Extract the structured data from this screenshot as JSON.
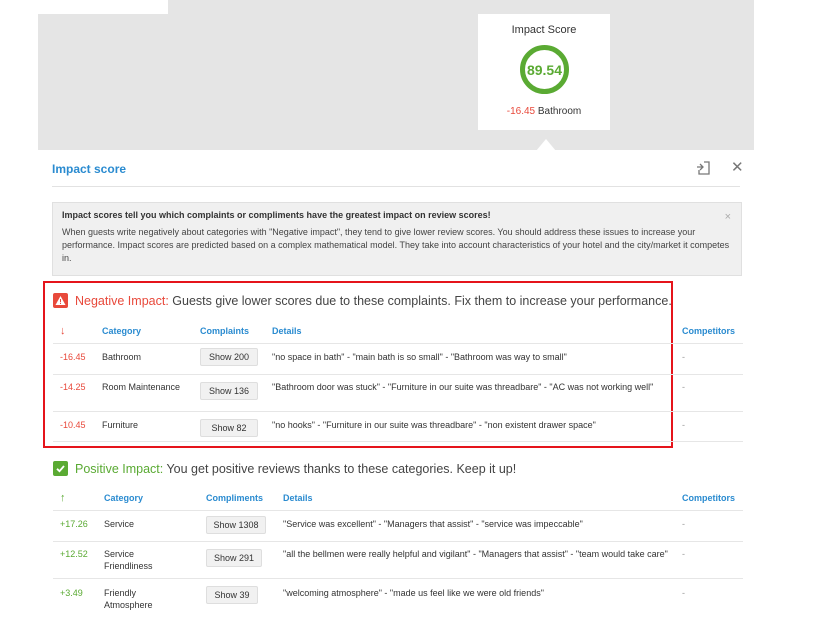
{
  "score_card": {
    "title": "Impact Score",
    "value": "89.54",
    "top_delta": "-16.45",
    "top_category": "Bathroom"
  },
  "panel": {
    "title": "Impact score",
    "close": "✕"
  },
  "info": {
    "title": "Impact scores tell you which complaints or compliments have the greatest impact on review scores!",
    "body": "When guests write negatively about categories with \"Negative impact\", they tend to give lower review scores. You should address these issues to increase your performance. Impact scores are predicted based on a complex mathematical model. They take into account characteristics of your hotel and the city/market it competes in.",
    "close": "×"
  },
  "negative": {
    "lead": "Negative Impact:",
    "text": " Guests give lower scores due to these complaints. Fix them to increase your performance.",
    "headers": {
      "sort": "↓",
      "category": "Category",
      "count": "Complaints",
      "details": "Details",
      "competitors": "Competitors"
    },
    "rows": [
      {
        "score": "-16.45",
        "category": "Bathroom",
        "button": "Show 200",
        "details": "\"no space in bath\" - \"main bath is so small\" - \"Bathroom was way to small\"",
        "competitors": "-"
      },
      {
        "score": "-14.25",
        "category": "Room Maintenance",
        "button": "Show 136",
        "details": "\"Bathroom door was stuck\" - \"Furniture in our suite was threadbare\" - \"AC was not working well\"",
        "competitors": "-"
      },
      {
        "score": "-10.45",
        "category": "Furniture",
        "button": "Show 82",
        "details": "\"no hooks\" - \"Furniture in our suite was threadbare\" - \"non existent drawer space\"",
        "competitors": "-"
      }
    ]
  },
  "positive": {
    "lead": "Positive Impact:",
    "text": " You get positive reviews thanks to these categories. Keep it up!",
    "headers": {
      "sort": "↑",
      "category": "Category",
      "count": "Compliments",
      "details": "Details",
      "competitors": "Competitors"
    },
    "rows": [
      {
        "score": "+17.26",
        "category": "Service",
        "button": "Show 1308",
        "details": "\"Service was excellent\" - \"Managers that assist\" - \"service was impeccable\"",
        "competitors": "-"
      },
      {
        "score": "+12.52",
        "category": "Service Friendliness",
        "button": "Show 291",
        "details": "\"all the bellmen were really helpful and vigilant\" - \"Managers that assist\" - \"team would take care\"",
        "competitors": "-"
      },
      {
        "score": "+3.49",
        "category": "Friendly Atmosphere",
        "button": "Show 39",
        "details": "\"welcoming atmosphere\" - \"made us feel like we were old friends\"",
        "competitors": "-"
      }
    ]
  },
  "colors": {
    "accent": "#2a8bd0",
    "negative": "#e8493b",
    "positive": "#5aaa33",
    "highlight_box": "#e5141b"
  }
}
